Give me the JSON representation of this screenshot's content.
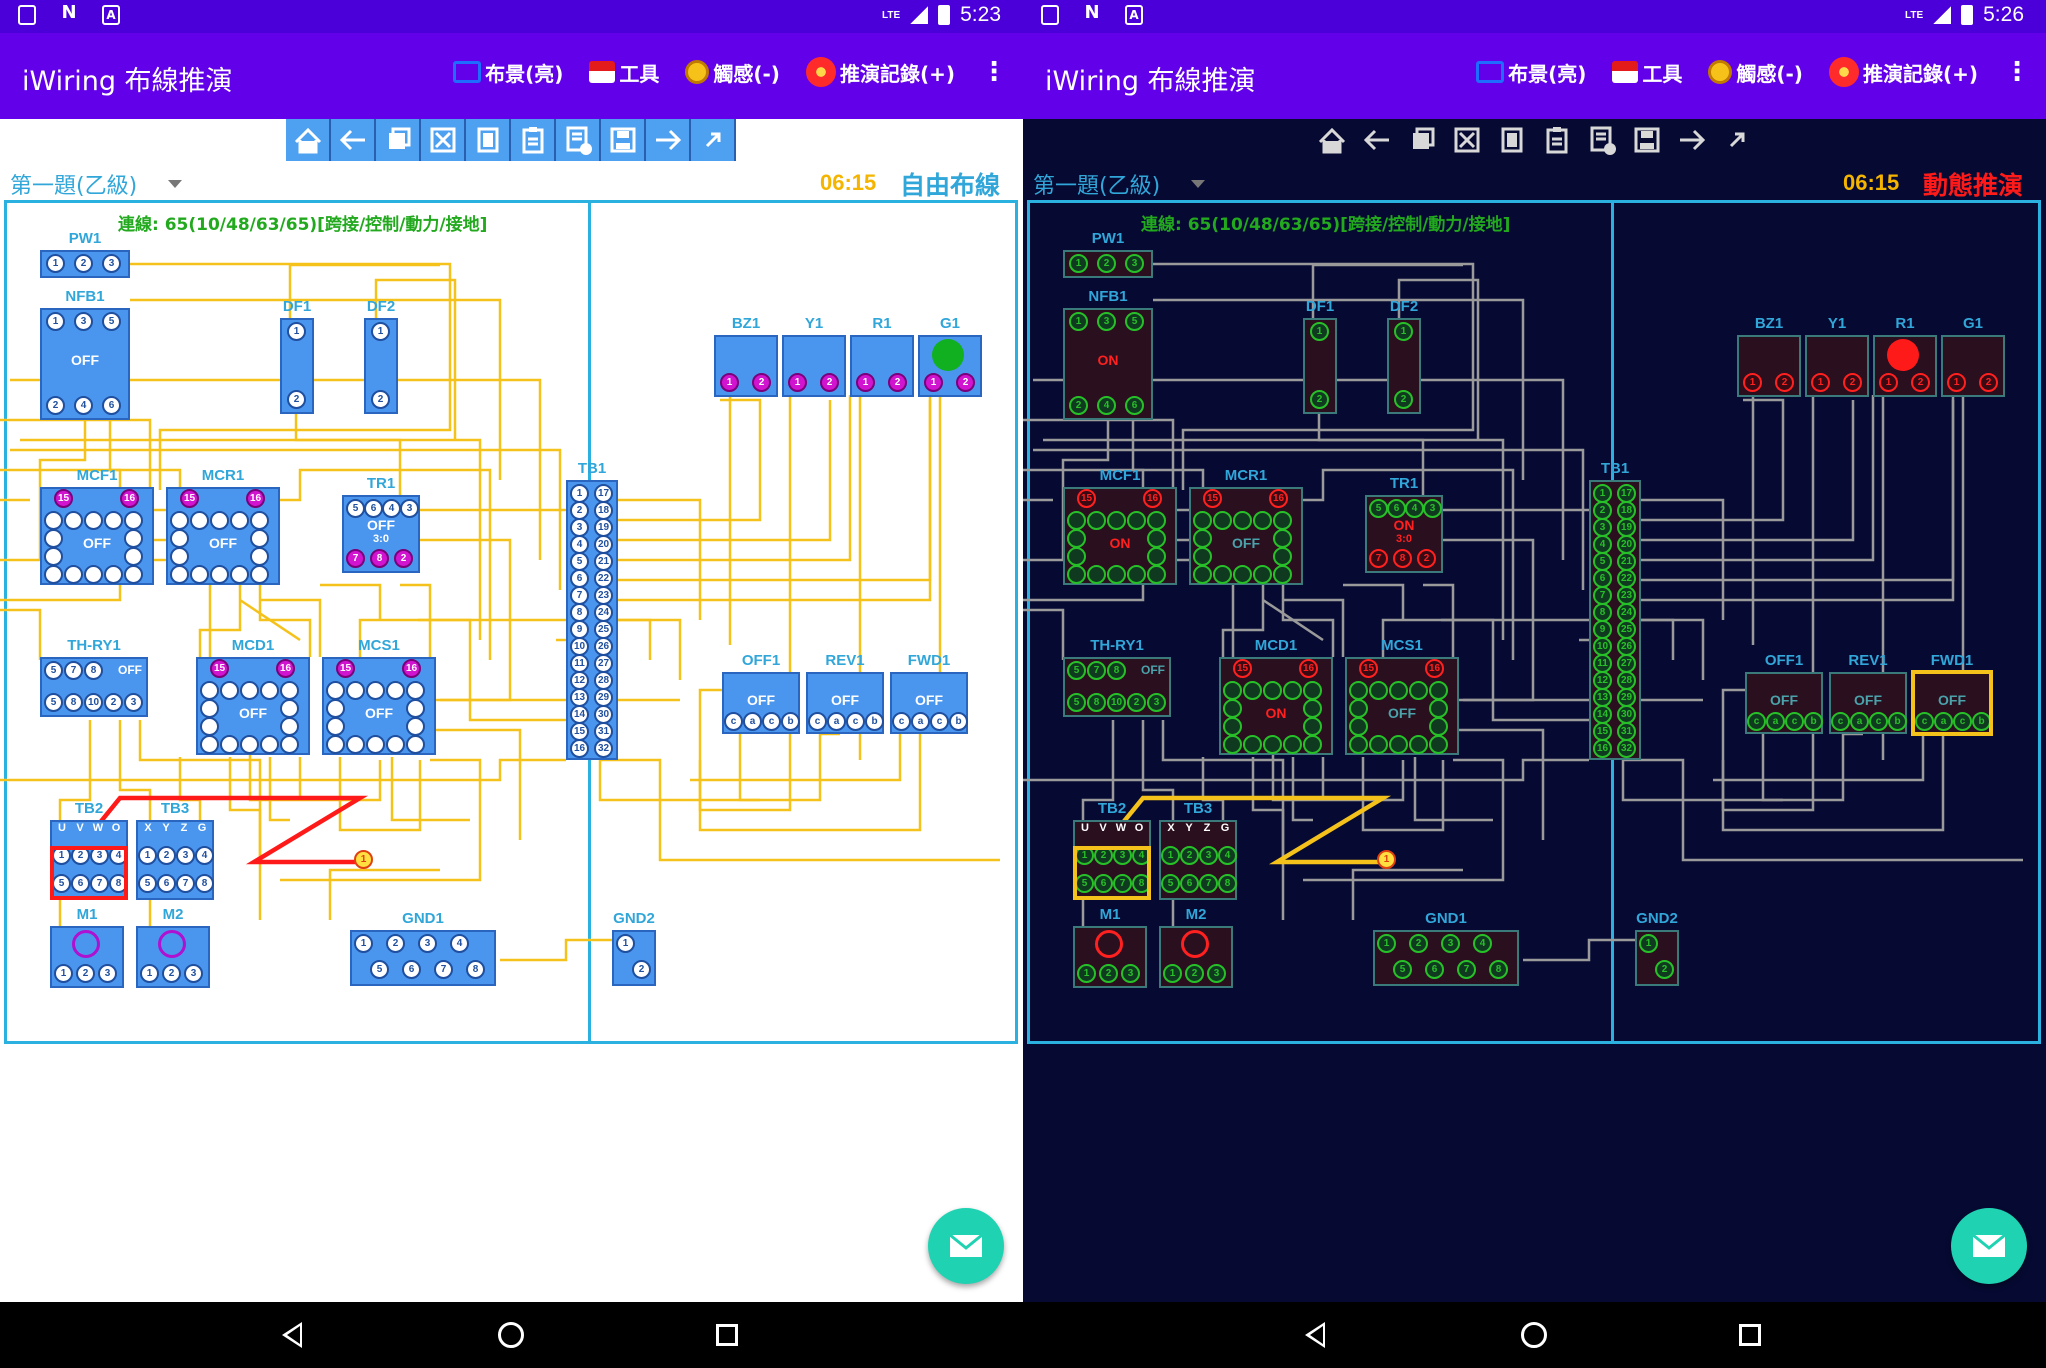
{
  "status_left": {
    "time": "5:23"
  },
  "status_right": {
    "time": "5:26"
  },
  "status_icons": [
    "sd-card-icon",
    "nfc-icon",
    "font-download-icon"
  ],
  "lte_label": "LTE",
  "app": {
    "title": "iWiring 布線推演",
    "menu": [
      {
        "label": "布景(亮)",
        "icon": "cast-icon"
      },
      {
        "label": "工具",
        "icon": "tools-icon"
      },
      {
        "label": "觸感(-)",
        "icon": "touch-icon"
      },
      {
        "label": "推演記錄(+)",
        "icon": "record-icon"
      }
    ],
    "overflow": "⋮"
  },
  "toolbar_icons": [
    "home-icon",
    "arrow-left-icon",
    "copy-icon",
    "cut-icon",
    "paste-icon",
    "clipboard-icon",
    "delete-doc-icon",
    "save-icon",
    "arrow-right-icon",
    "expand-icon"
  ],
  "question": {
    "title": "第一題(乙級)",
    "timer": "06:15"
  },
  "left_mode": "自由布線",
  "right_mode": "動態推演",
  "wire_count": "連線: 65(10/48/63/65)[跨接/控制/動力/接地]",
  "components": {
    "PW1": {
      "label": "PW1",
      "pins": [
        "1",
        "2",
        "3"
      ]
    },
    "NFB1": {
      "label": "NFB1",
      "pins_top": [
        "1",
        "3",
        "5"
      ],
      "pins_bottom": [
        "2",
        "4",
        "6"
      ],
      "state_left": "OFF",
      "state_right": "ON"
    },
    "DF1": {
      "label": "DF1",
      "pins": [
        "1",
        "2"
      ]
    },
    "DF2": {
      "label": "DF2",
      "pins": [
        "1",
        "2"
      ]
    },
    "BZ1": {
      "label": "BZ1",
      "pins": [
        "1",
        "2"
      ]
    },
    "Y1": {
      "label": "Y1",
      "pins": [
        "1",
        "2"
      ]
    },
    "R1": {
      "label": "R1",
      "pins": [
        "1",
        "2"
      ]
    },
    "G1": {
      "label": "G1",
      "pins": [
        "1",
        "2"
      ]
    },
    "MCF1": {
      "label": "MCF1",
      "top_pins": [
        "15",
        "16"
      ],
      "state_left": "OFF",
      "state_right": "ON"
    },
    "MCR1": {
      "label": "MCR1",
      "top_pins": [
        "15",
        "16"
      ],
      "state_left": "OFF",
      "state_right": "OFF"
    },
    "TR1": {
      "label": "TR1",
      "pins": [
        "5",
        "6",
        "4",
        "3"
      ],
      "state_left": "OFF",
      "state_right": "ON",
      "timer": "3:0",
      "bottom_pins": [
        "7",
        "8",
        "2"
      ]
    },
    "TB1": {
      "label": "TB1",
      "left_pins": [
        "1",
        "2",
        "3",
        "4",
        "5",
        "6",
        "7",
        "8",
        "9",
        "10",
        "11",
        "12",
        "13",
        "14",
        "15",
        "16"
      ],
      "right_pins": [
        "17",
        "18",
        "19",
        "20",
        "21",
        "22",
        "23",
        "24",
        "25",
        "26",
        "27",
        "28",
        "29",
        "30",
        "31",
        "32"
      ]
    },
    "THRY1": {
      "label": "TH-RY1",
      "pins_top": [
        "5",
        "7",
        "8"
      ],
      "pins_bottom": [
        "5",
        "8",
        "10",
        "2",
        "3"
      ],
      "state": "OFF"
    },
    "MCD1": {
      "label": "MCD1",
      "top_pins": [
        "15",
        "16"
      ],
      "state_left": "OFF",
      "state_right": "ON"
    },
    "MCS1": {
      "label": "MCS1",
      "top_pins": [
        "15",
        "16"
      ],
      "state_left": "OFF",
      "state_right": "OFF"
    },
    "OFF1": {
      "label": "OFF1",
      "state": "OFF",
      "pins": [
        "c",
        "a",
        "c",
        "b"
      ]
    },
    "REV1": {
      "label": "REV1",
      "state": "OFF",
      "pins": [
        "c",
        "a",
        "c",
        "b"
      ]
    },
    "FWD1": {
      "label": "FWD1",
      "state": "OFF",
      "pins": [
        "c",
        "a",
        "c",
        "b"
      ]
    },
    "TB2": {
      "label": "TB2",
      "head": [
        "U",
        "V",
        "W",
        "O"
      ],
      "pins_top": [
        "1",
        "2",
        "3",
        "4"
      ],
      "pins_bottom": [
        "5",
        "6",
        "7",
        "8"
      ]
    },
    "TB3": {
      "label": "TB3",
      "head": [
        "X",
        "Y",
        "Z",
        "G"
      ],
      "pins_top": [
        "1",
        "2",
        "3",
        "4"
      ],
      "pins_bottom": [
        "5",
        "6",
        "7",
        "8"
      ]
    },
    "M1": {
      "label": "M1",
      "pins": [
        "1",
        "2",
        "3"
      ]
    },
    "M2": {
      "label": "M2",
      "pins": [
        "1",
        "2",
        "3"
      ]
    },
    "GND1": {
      "label": "GND1",
      "pins_top": [
        "1",
        "2",
        "3",
        "4"
      ],
      "pins_bottom": [
        "5",
        "6",
        "7",
        "8"
      ]
    },
    "GND2": {
      "label": "GND2",
      "pins": [
        "1",
        "2"
      ]
    },
    "probe": {
      "label": "1"
    }
  },
  "colors": {
    "appbar": "#6200ea",
    "statusbar": "#4b00d9",
    "accent_cyan": "#31a6d9",
    "timer": "#f4b400",
    "wire_yellow": "#f5c21b",
    "wire_gray": "#9a9a9a",
    "active_red": "#ff1a1a",
    "pin_green": "#28c028",
    "dark_bg": "#060a32",
    "fab": "#1fd2b2"
  },
  "fab_icon": "email-icon",
  "nav": [
    "back-icon",
    "home-circle-icon",
    "recents-icon"
  ]
}
